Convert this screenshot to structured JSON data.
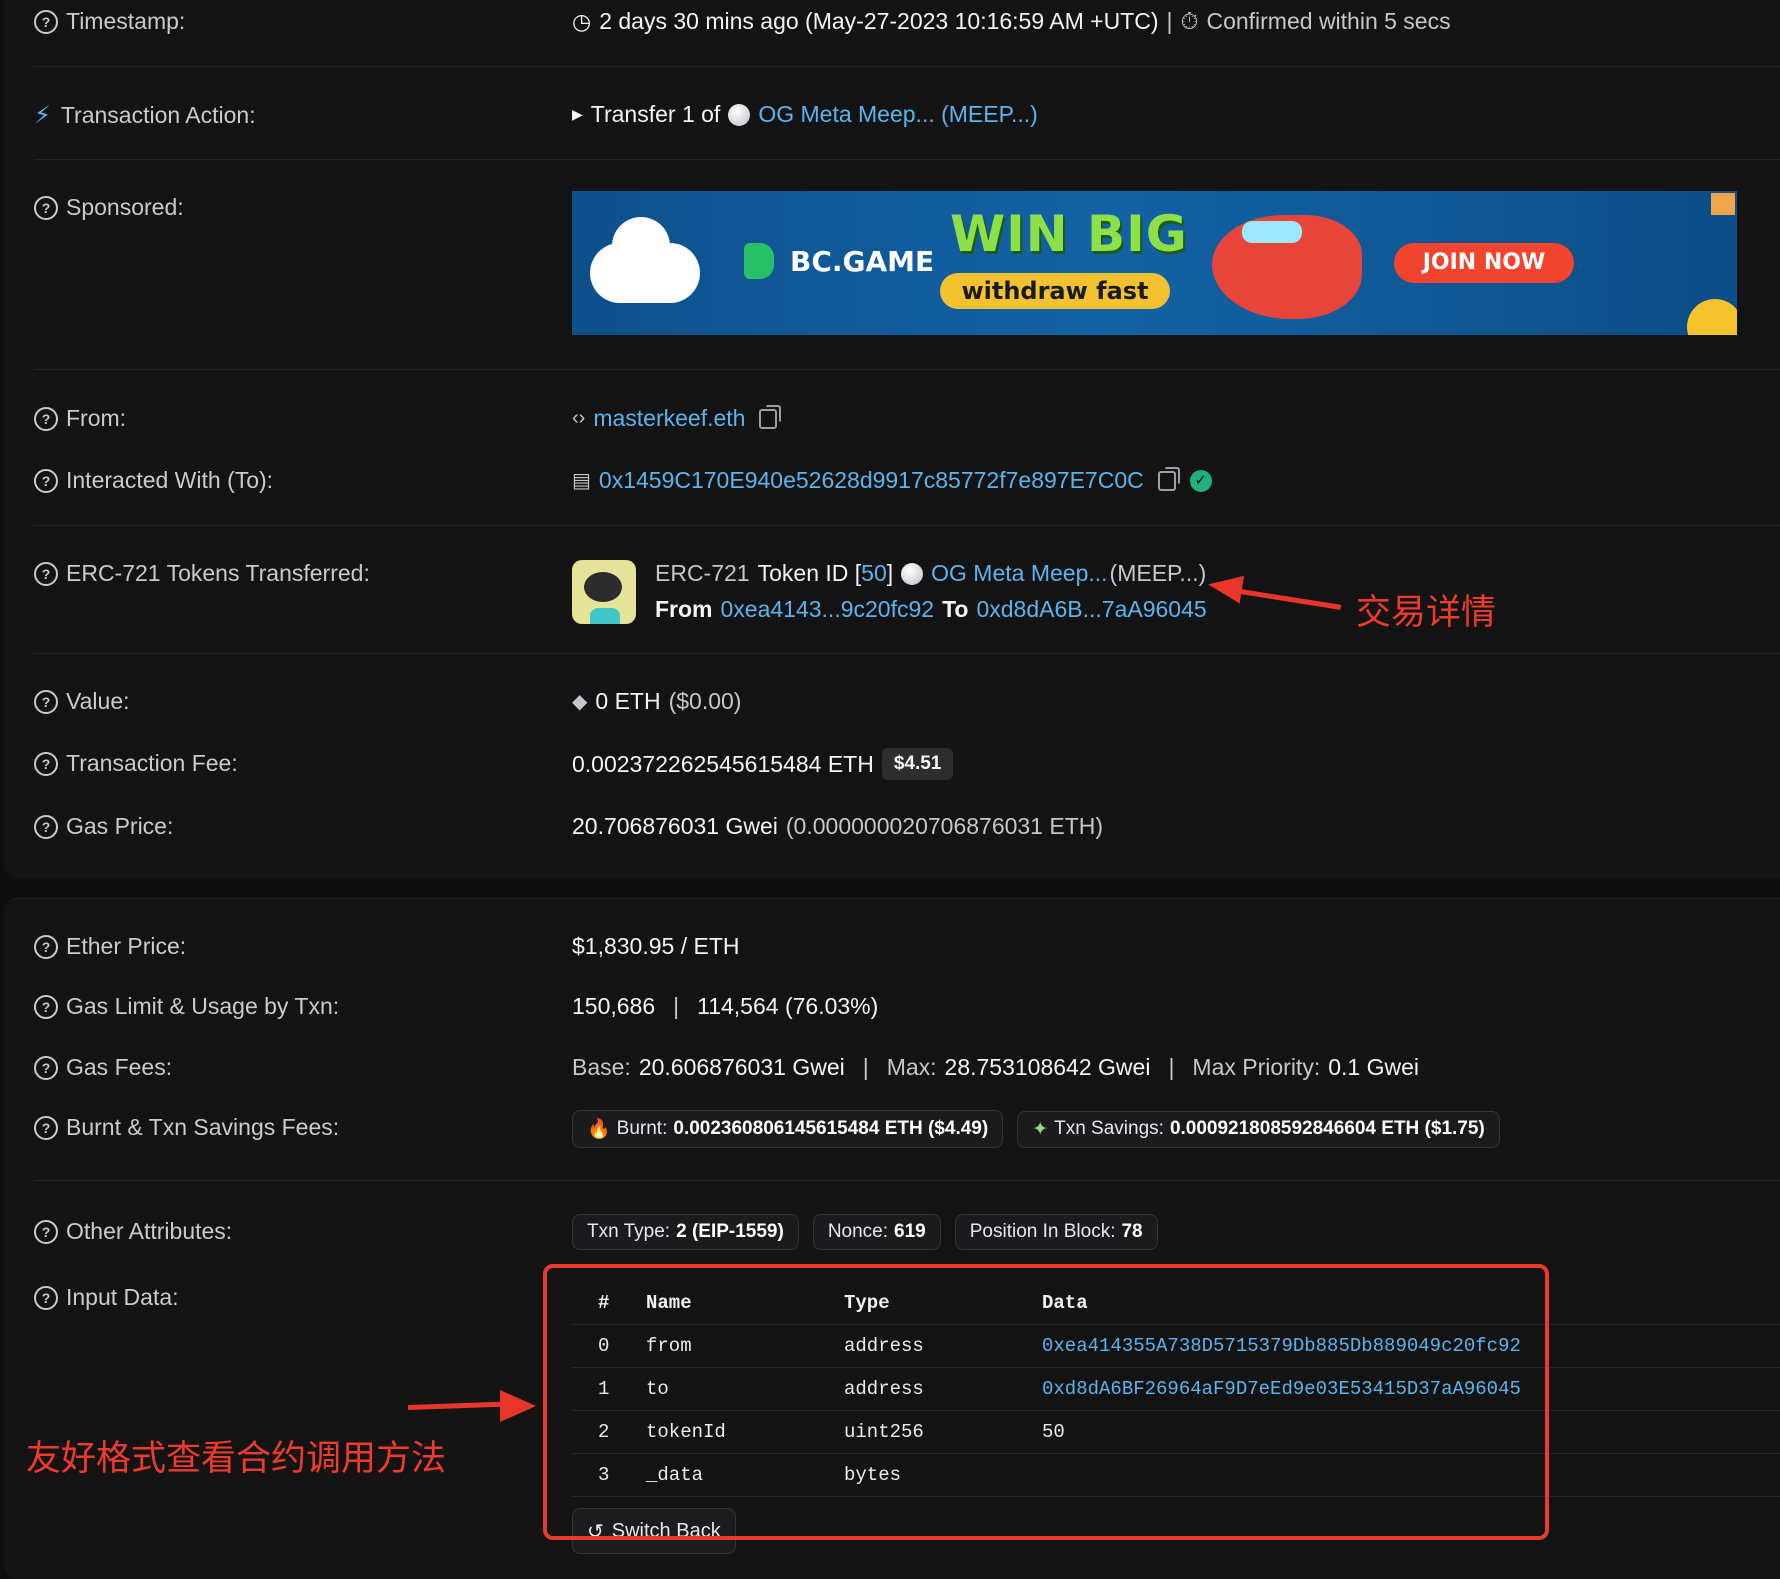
{
  "timestamp": {
    "label": "Timestamp:",
    "value": "2 days 30 mins ago (May-27-2023 10:16:59 AM +UTC)",
    "separator": "|",
    "confirmed": "Confirmed within 5 secs"
  },
  "action": {
    "label": "Transaction Action:",
    "prefix": "Transfer 1 of",
    "token": "OG Meta Meep... (MEEP...)"
  },
  "sponsored": {
    "label": "Sponsored:",
    "brand": "BC.GAME",
    "headline": "WIN BIG",
    "sub": "withdraw fast",
    "cta": "JOIN NOW"
  },
  "from": {
    "label": "From:",
    "value": "masterkeef.eth"
  },
  "to": {
    "label": "Interacted With (To):",
    "value": "0x1459C170E940e52628d9917c85772f7e897E7C0C"
  },
  "erc721": {
    "label": "ERC-721 Tokens Transferred:",
    "prefix": "ERC-721",
    "token_id_label": "Token ID [",
    "token_id": "50",
    "token_id_close": "]",
    "token_name": "OG Meta Meep...",
    "token_symbol": "(MEEP...)",
    "from_label": "From",
    "from_addr": "0xea4143...9c20fc92",
    "to_label": "To",
    "to_addr": "0xd8dA6B...7aA96045"
  },
  "value": {
    "label": "Value:",
    "amount": "0 ETH",
    "usd": "($0.00)"
  },
  "fee": {
    "label": "Transaction Fee:",
    "amount": "0.002372262545615484 ETH",
    "usd": "$4.51"
  },
  "gas_price": {
    "label": "Gas Price:",
    "gwei": "20.706876031 Gwei",
    "eth": "(0.000000020706876031 ETH)"
  },
  "ether_price": {
    "label": "Ether Price:",
    "value": "$1,830.95 / ETH"
  },
  "gas_limit": {
    "label": "Gas Limit & Usage by Txn:",
    "limit": "150,686",
    "separator": "|",
    "usage": "114,564 (76.03%)"
  },
  "gas_fees": {
    "label": "Gas Fees:",
    "base_label": "Base:",
    "base": "20.606876031 Gwei",
    "max_label": "Max:",
    "max": "28.753108642 Gwei",
    "priority_label": "Max Priority:",
    "priority": "0.1 Gwei",
    "separator": "|"
  },
  "burnt": {
    "label": "Burnt & Txn Savings Fees:",
    "burnt_label": "Burnt:",
    "burnt_value": "0.002360806145615484 ETH ($4.49)",
    "savings_label": "Txn Savings:",
    "savings_value": "0.000921808592846604 ETH ($1.75)"
  },
  "other": {
    "label": "Other Attributes:",
    "type_label": "Txn Type:",
    "type_value": "2 (EIP-1559)",
    "nonce_label": "Nonce:",
    "nonce_value": "619",
    "position_label": "Position In Block:",
    "position_value": "78"
  },
  "input": {
    "label": "Input Data:",
    "columns": [
      "#",
      "Name",
      "Type",
      "Data"
    ],
    "rows": [
      {
        "idx": "0",
        "name": "from",
        "type": "address",
        "data": "0xea414355A738D5715379Db885Db889049c20fc92"
      },
      {
        "idx": "1",
        "name": "to",
        "type": "address",
        "data": "0xd8dA6BF26964aF9D7eEd9e03E53415D37aA96045"
      },
      {
        "idx": "2",
        "name": "tokenId",
        "type": "uint256",
        "data": "50"
      },
      {
        "idx": "3",
        "name": "_data",
        "type": "bytes",
        "data": ""
      }
    ],
    "switch_back": "Switch Back"
  },
  "annotations": {
    "detail": "交易详情",
    "friendly": "友好格式查看合约调用方法"
  },
  "colors": {
    "link": "#5cb4ee",
    "annotation": "#ef3b2c",
    "background": "#131313"
  }
}
